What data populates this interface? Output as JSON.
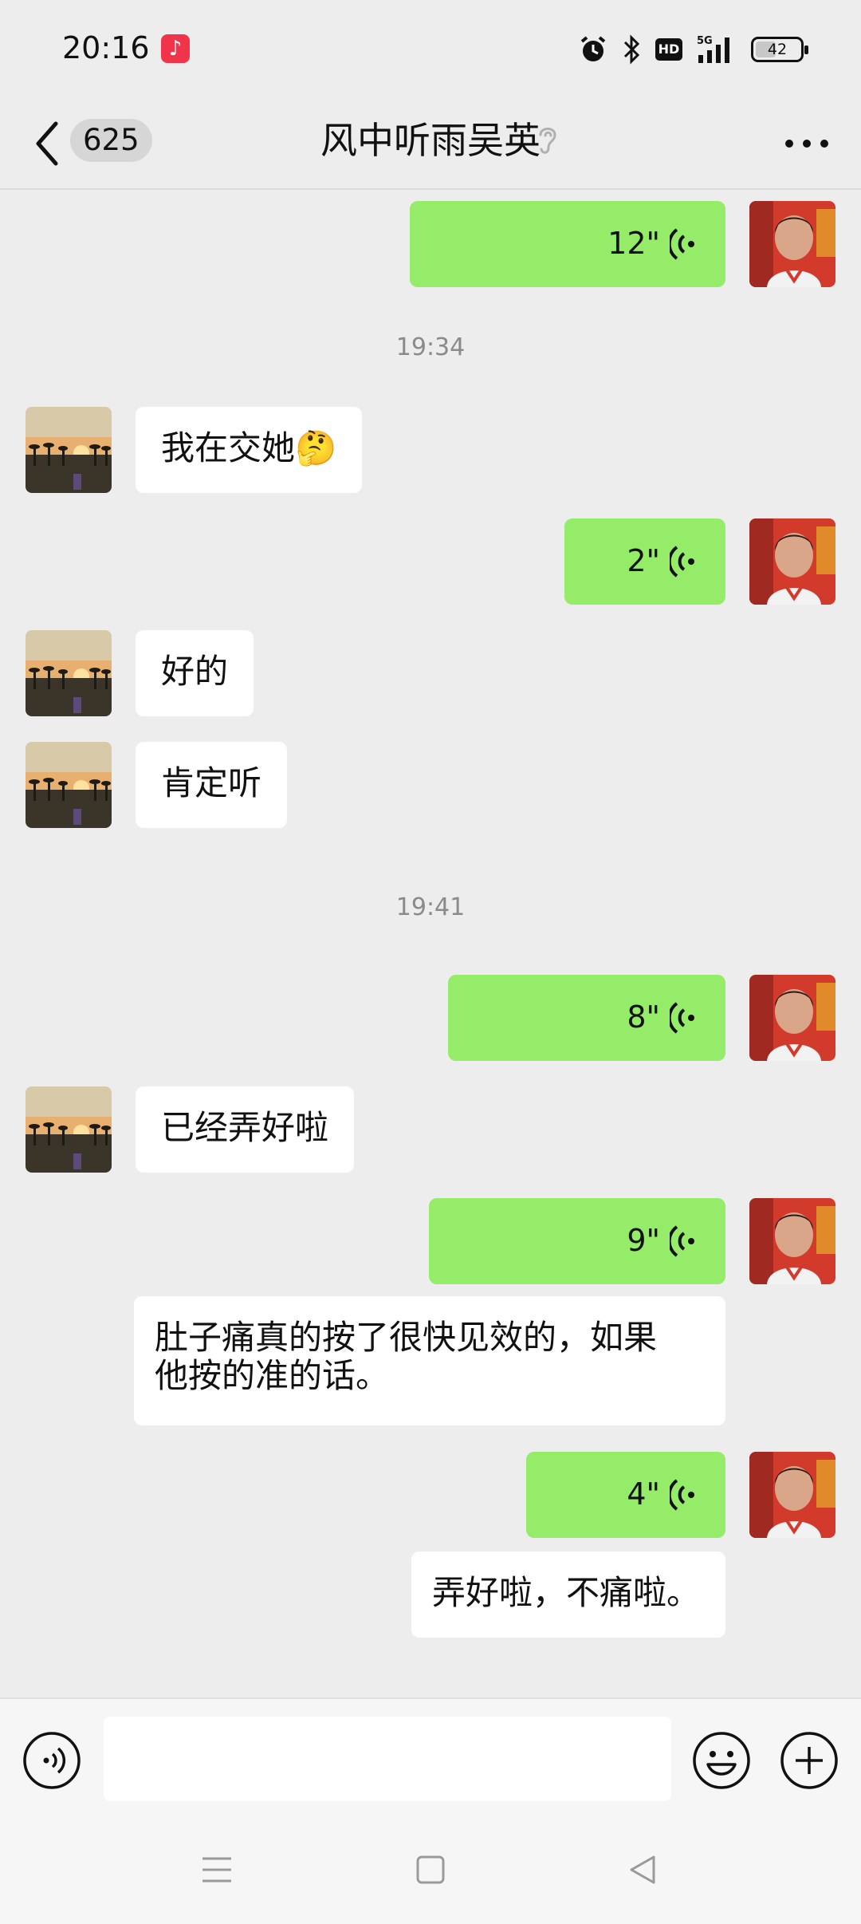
{
  "status_bar": {
    "time": "20:16",
    "battery": "42",
    "network": "5G",
    "hd": "HD"
  },
  "header": {
    "unread_count": "625",
    "title": "风中听雨吴英"
  },
  "messages": [
    {
      "side": "right",
      "type": "voice",
      "duration": "12\""
    },
    {
      "type": "time",
      "text": "19:34"
    },
    {
      "side": "left",
      "type": "text",
      "text": "我在交她🤔"
    },
    {
      "side": "right",
      "type": "voice",
      "duration": "2\""
    },
    {
      "side": "left",
      "type": "text",
      "text": "好的"
    },
    {
      "side": "left",
      "type": "text",
      "text": "肯定听"
    },
    {
      "type": "time",
      "text": "19:41"
    },
    {
      "side": "right",
      "type": "voice",
      "duration": "8\""
    },
    {
      "side": "left",
      "type": "text",
      "text": "已经弄好啦"
    },
    {
      "side": "right",
      "type": "voice",
      "duration": "9\""
    },
    {
      "side": "right",
      "type": "transcript",
      "text_line1": "肚子痛真的按了很快见效的，如果",
      "text_line2": "他按的准的话。"
    },
    {
      "side": "right",
      "type": "voice",
      "duration": "4\""
    },
    {
      "side": "right",
      "type": "transcript",
      "text": "弄好啦，不痛啦。"
    }
  ],
  "input": {
    "placeholder": ""
  },
  "colors": {
    "outgoing_bubble": "#95ec69",
    "incoming_bubble": "#ffffff",
    "background": "#ededed",
    "music_icon": "#f0354a"
  },
  "icons": [
    "music-icon",
    "alarm-icon",
    "bluetooth-icon",
    "signal-icon",
    "battery-icon",
    "back-icon",
    "ear-icon",
    "more-icon",
    "voice-wave-icon",
    "voice-input-icon",
    "emoji-icon",
    "plus-icon",
    "menu-icon",
    "home-icon",
    "back-triangle-icon"
  ]
}
